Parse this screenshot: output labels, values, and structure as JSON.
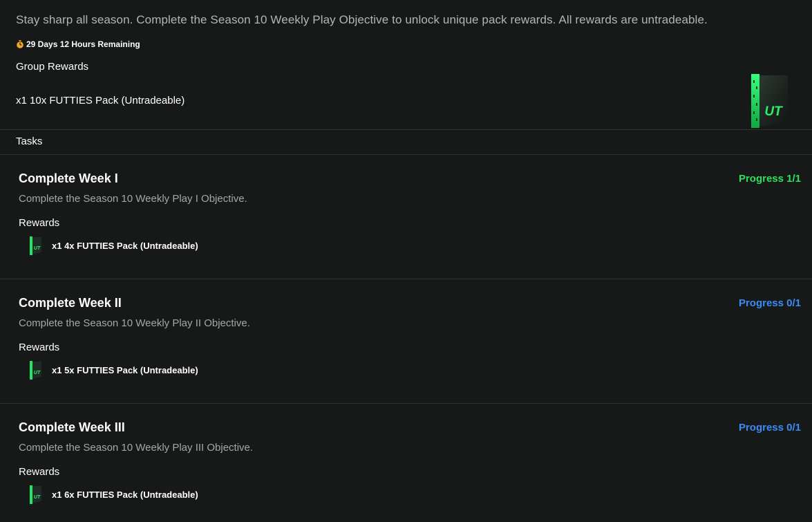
{
  "header": {
    "description": "Stay sharp all season. Complete the Season 10 Weekly Play Objective to unlock unique pack rewards. All rewards are untradeable.",
    "timer_text": "29 Days 12 Hours Remaining",
    "group_rewards_label": "Group Rewards",
    "group_reward_item": "x1 10x FUTTIES Pack (Untradeable)",
    "pack_logo_text": "UT"
  },
  "tasks_label": "Tasks",
  "tasks": [
    {
      "title": "Complete Week I",
      "progress": "Progress 1/1",
      "progress_color": "#2fe05c",
      "description": "Complete the Season 10 Weekly Play I Objective.",
      "rewards_label": "Rewards",
      "reward_item": "x1 4x FUTTIES Pack (Untradeable)"
    },
    {
      "title": "Complete Week II",
      "progress": "Progress 0/1",
      "progress_color": "#3a8bf5",
      "description": "Complete the Season 10 Weekly Play II Objective.",
      "rewards_label": "Rewards",
      "reward_item": "x1 5x FUTTIES Pack (Untradeable)"
    },
    {
      "title": "Complete Week III",
      "progress": "Progress 0/1",
      "progress_color": "#3a8bf5",
      "description": "Complete the Season 10 Weekly Play III Objective.",
      "rewards_label": "Rewards",
      "reward_item": "x1 6x FUTTIES Pack (Untradeable)"
    }
  ],
  "colors": {
    "background": "#161918",
    "divider": "#2e3231",
    "pack_green": "#1fe060"
  },
  "icons": {
    "timer": "stopwatch-icon",
    "pack": "futties-pack-icon"
  }
}
